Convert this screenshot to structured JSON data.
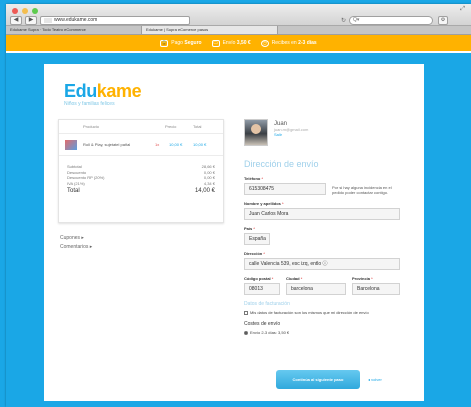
{
  "browser": {
    "url": "www.edukame.com",
    "search_placeholder": "Q▾",
    "tabs": [
      "Edukame Supra · Todo Teatro eCommerce",
      "Edukame | Supra eComerce pasos"
    ],
    "controls": {
      "back": "◀",
      "forward": "▶",
      "page": "⚙"
    }
  },
  "yellowbar": {
    "items": [
      {
        "icon": "lock-icon",
        "text": "Pago ",
        "strong": "Seguro"
      },
      {
        "icon": "truck-icon",
        "text": "Envío ",
        "strong": "3,50 €"
      },
      {
        "icon": "clock-icon",
        "text": "Recibes en ",
        "strong": "2-3 días"
      }
    ]
  },
  "brand": {
    "title_a": "Edu",
    "title_b": "kame",
    "subtitle": "Niños y familias felices"
  },
  "summary": {
    "headers": [
      "Producto",
      "Precio",
      "Total"
    ],
    "product": {
      "name": "Roll & Play, sujetatel pañal",
      "qty": "1x",
      "price": "10,00 €",
      "total": "10,00 €"
    },
    "lines": [
      {
        "label": "Subtotal",
        "value": "28,66 €"
      },
      {
        "label": "Descuento",
        "value": "0,00 €"
      },
      {
        "label": "Descuento RP (20%)",
        "value": "0,00 €"
      },
      {
        "label": "IVA (21%)",
        "value": "4,34 €"
      }
    ],
    "total_label": "Total",
    "total_value": "14,00 €"
  },
  "side_links": [
    "Cupones ▸",
    "Comentarios ▸"
  ],
  "user": {
    "name": "Juan",
    "email": "juan.m@gmail.com",
    "link": "Salir"
  },
  "form": {
    "title": "Dirección de envío",
    "phone_label": "Teléfono",
    "phone_value": "615308475",
    "phone_hint": "Por si hay alguna incidencia en el pedido poder contactar contigo.",
    "name_label": "Nombre y apellidos",
    "name_value": "Juan Carlos Mora",
    "country_label": "País",
    "country_value": "España",
    "address_label": "Dirección",
    "address_value": "calle Valencia 539, esc izq, entlo ⓘ",
    "zip_label": "Código postal",
    "zip_value": "08013",
    "city_label": "Ciudad",
    "city_value": "barcelona",
    "province_label": "Provincia",
    "province_value": "Barcelona",
    "billing_link": "Datos de facturación",
    "billing_check": "Mis datos de facturación son los mismos que mi dirección de envío",
    "shipping_title": "Costes de envío",
    "shipping_option": "Envío 2-3 días: 3,50 €"
  },
  "cta": {
    "label": "Continúa al siguiente paso",
    "back": "◂ volver"
  },
  "colors": {
    "accent": "#1aa7e6",
    "brand_yellow": "#ffb200",
    "required": "#e25151"
  }
}
